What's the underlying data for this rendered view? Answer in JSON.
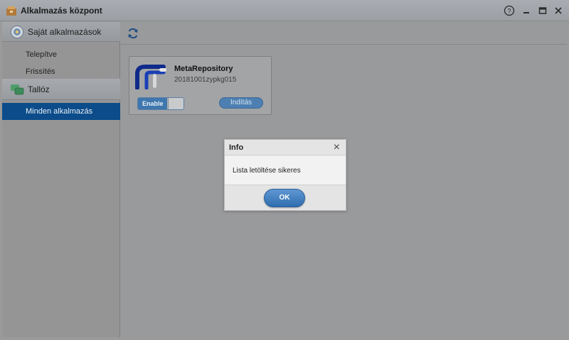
{
  "window": {
    "title": "Alkalmazás központ",
    "icon": "app-center-icon",
    "controls": [
      "help-icon",
      "minimize-icon",
      "maximize-icon",
      "close-icon"
    ]
  },
  "sidebar": {
    "section_own": {
      "label": "Saját alkalmazások",
      "icon": "own-apps-icon"
    },
    "items_own": [
      {
        "label": "Telepítve"
      },
      {
        "label": "Frissítés"
      }
    ],
    "section_browse": {
      "label": "Tallóz",
      "icon": "browse-icon"
    },
    "items_browse": [
      {
        "label": "Minden alkalmazás",
        "active": true
      }
    ]
  },
  "toolbar": {
    "refresh_icon": "refresh-icon"
  },
  "app_card": {
    "name": "MetaRepository",
    "version": "20181001zypkg015",
    "toggle_label": "Enable",
    "launch_label": "Indítás"
  },
  "dialog": {
    "title": "Info",
    "message": "Lista letöltése sikeres",
    "ok_label": "OK"
  },
  "colors": {
    "accent": "#0c4c8a",
    "button": "#3f76ad"
  }
}
